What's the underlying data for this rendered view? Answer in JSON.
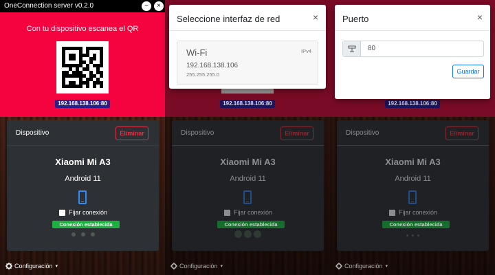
{
  "window": {
    "title": "OneConnection server v0.2.0",
    "min_glyph": "−",
    "close_glyph": "×"
  },
  "qr": {
    "caption": "Con tu dispositivo escanea el QR",
    "address": "192.168.138.106:80"
  },
  "device_card": {
    "title": "Dispositivo",
    "delete_label": "Eliminar",
    "device_name": "Xiaomi Mi A3",
    "os": "Android 11",
    "fix_label": "Fijar conexión",
    "status": "Conexión establecida"
  },
  "config": {
    "label": "Configuración",
    "caret": "▾"
  },
  "interface_modal": {
    "title": "Seleccione interfaz de red",
    "close": "×",
    "item": {
      "name": "Wi-Fi",
      "type": "IPv4",
      "ip": "192.168.138.106",
      "mask": "255.255.255.0"
    }
  },
  "port_modal": {
    "title": "Puerto",
    "close": "×",
    "value": "80",
    "save_label": "Guardar"
  },
  "colors": {
    "accent_red": "#f4033f",
    "success": "#1fb140",
    "primary": "#0d6efd",
    "danger": "#dc3545",
    "badge": "#2a1f8a"
  },
  "icons": [
    "close-icon",
    "minimize-icon",
    "qr-code-icon",
    "phone-icon",
    "gear-icon",
    "port-icon"
  ]
}
